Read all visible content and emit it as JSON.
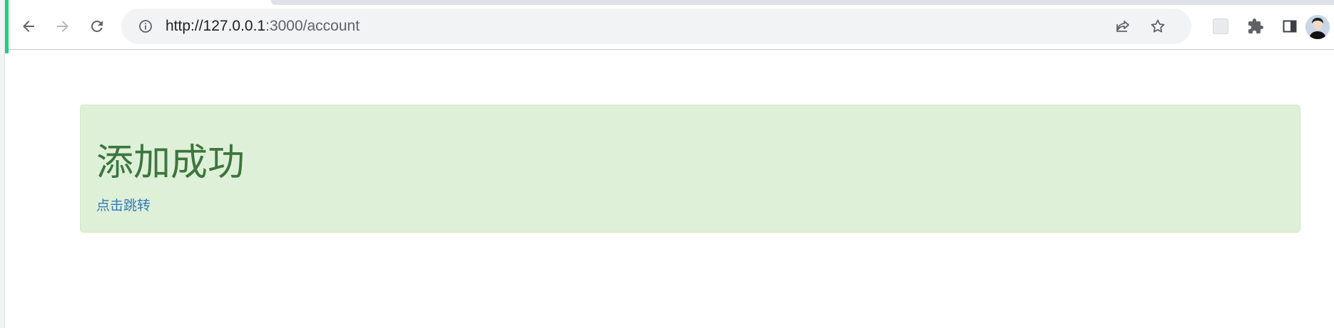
{
  "browser": {
    "url": {
      "host_part": "http://127.0.0.1",
      "rest_part": ":3000/account"
    },
    "icons": {
      "back": "arrow-left-icon",
      "forward": "arrow-right-icon",
      "reload": "reload-icon",
      "site_info": "info-icon",
      "share": "share-icon",
      "bookmark": "star-icon",
      "extension": "extension-icon",
      "extensions_menu": "puzzle-icon",
      "side_panel": "side-panel-icon",
      "profile": "avatar-icon"
    },
    "colors": {
      "accent_strip": "#1ed07a",
      "omnibox_bg": "#f1f3f4"
    }
  },
  "content": {
    "alert": {
      "title": "添加成功",
      "link_text": "点击跳转"
    },
    "colors": {
      "alert_bg": "#dff0d8",
      "alert_border": "#d0e9c6",
      "title_color": "#3c763d",
      "link_color": "#337ab7"
    }
  }
}
